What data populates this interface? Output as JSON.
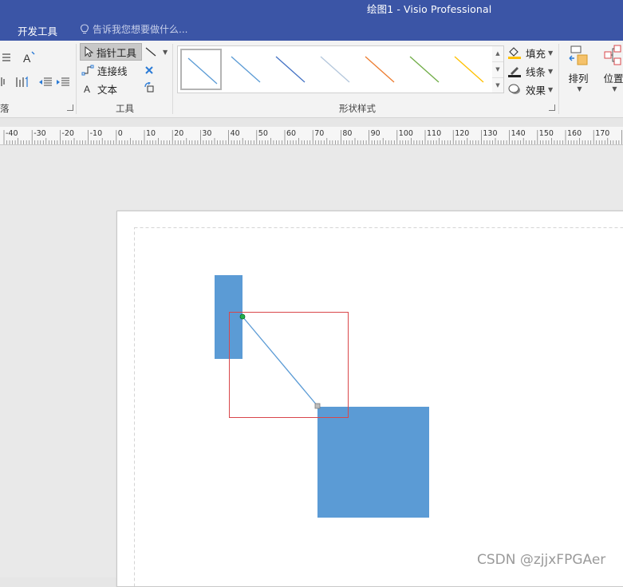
{
  "window": {
    "title": "绘图1 - Visio Professional"
  },
  "tabbar": {
    "active_tab": "开发工具",
    "tell_me_placeholder": "告诉我您想要做什么..."
  },
  "ribbon": {
    "left_group_label_fragment": "落",
    "tools_group": {
      "label": "工具",
      "pointer_tool": "指针工具",
      "connector": "连接线",
      "text": "文本"
    },
    "shape_styles_group": {
      "label": "形状样式",
      "fill": "填充",
      "line": "线条",
      "effects": "效果"
    },
    "arrange": {
      "arrange_label": "排列",
      "position_label": "位置"
    }
  },
  "ruler": {
    "labels": [
      "-40",
      "-30",
      "-20",
      "-10",
      "0",
      "10",
      "20",
      "30",
      "40",
      "50",
      "60",
      "70",
      "80",
      "90",
      "100",
      "110",
      "120",
      "130",
      "140",
      "150",
      "160",
      "170",
      "1"
    ]
  },
  "gallery": {
    "line_colors": [
      "#5b9bd5",
      "#5b9bd5",
      "#4472c4",
      "#b4c7dc",
      "#ed7d31",
      "#70ad47",
      "#ffc000"
    ]
  },
  "canvas": {
    "shape_color": "#5b9bd5",
    "connector_color": "#5b9bd5",
    "selection_color": "#d9464a"
  },
  "watermark": "CSDN @zjjxFPGAer"
}
